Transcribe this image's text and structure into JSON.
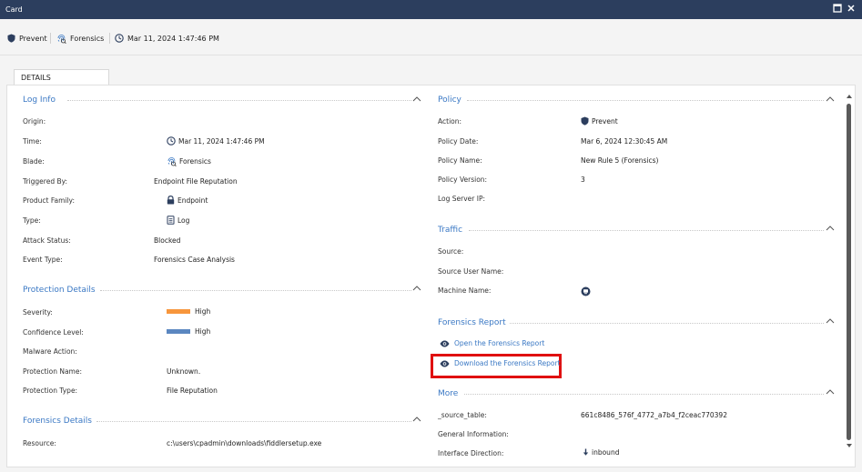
{
  "window": {
    "title": "Card"
  },
  "summary": {
    "action": "Prevent",
    "blade": "Forensics",
    "time": "Mar 11, 2024 1:47:46 PM"
  },
  "tabs": [
    {
      "label": "DETAILS"
    }
  ],
  "log_info": {
    "title": "Log Info",
    "rows": [
      {
        "label": "Origin:",
        "value": ""
      },
      {
        "label": "Time:",
        "value": "Mar 11, 2024 1:47:46 PM",
        "icon": "clock-icon"
      },
      {
        "label": "Blade:",
        "value": "Forensics",
        "icon": "fingerprint-icon"
      },
      {
        "label": "Triggered By:",
        "value": "Endpoint File Reputation"
      },
      {
        "label": "Product Family:",
        "value": "Endpoint",
        "icon": "lock-icon"
      },
      {
        "label": "Type:",
        "value": "Log",
        "icon": "document-icon"
      },
      {
        "label": "Attack Status:",
        "value": "Blocked"
      },
      {
        "label": "Event Type:",
        "value": "Forensics Case Analysis"
      }
    ]
  },
  "protection_details": {
    "title": "Protection Details",
    "rows": [
      {
        "label": "Severity:",
        "value": "High",
        "bar_color": "#f7963c"
      },
      {
        "label": "Confidence Level:",
        "value": "High",
        "bar_color": "#5b87c0"
      },
      {
        "label": "Malware Action:",
        "value": ""
      },
      {
        "label": "Protection Name:",
        "value": "Unknown."
      },
      {
        "label": "Protection Type:",
        "value": "File Reputation"
      }
    ]
  },
  "forensics_details": {
    "title": "Forensics Details",
    "rows": [
      {
        "label": "Resource:",
        "value": "c:\\users\\cpadmin\\downloads\\fiddlersetup.exe"
      }
    ]
  },
  "policy": {
    "title": "Policy",
    "rows": [
      {
        "label": "Action:",
        "value": "Prevent",
        "icon": "shield-icon"
      },
      {
        "label": "Policy Date:",
        "value": "Mar 6, 2024 12:30:45 AM"
      },
      {
        "label": "Policy Name:",
        "value": "New Rule 5 (Forensics)"
      },
      {
        "label": "Policy Version:",
        "value": "3"
      },
      {
        "label": "Log Server IP:",
        "value": ""
      }
    ]
  },
  "traffic": {
    "title": "Traffic",
    "rows": [
      {
        "label": "Source:",
        "value": ""
      },
      {
        "label": "Source User Name:",
        "value": ""
      },
      {
        "label": "Machine Name:",
        "value": "",
        "icon": "machine-icon"
      }
    ]
  },
  "forensics_report": {
    "title": "Forensics Report",
    "open_link": "Open the Forensics Report",
    "download_link": "Download the Forensics Report"
  },
  "more": {
    "title": "More",
    "rows": [
      {
        "label": "_source_table:",
        "value": "661c8486_576f_4772_a7b4_f2ceac770392"
      },
      {
        "label": "General Information:",
        "value": ""
      },
      {
        "label": "Interface Direction:",
        "value": "inbound",
        "icon": "arrow-down-icon"
      }
    ]
  },
  "colors": {
    "titlebar": "#2c3e5e",
    "accent": "#3a78c4",
    "highlight": "#e01010",
    "shield": "#2c3e5e"
  }
}
